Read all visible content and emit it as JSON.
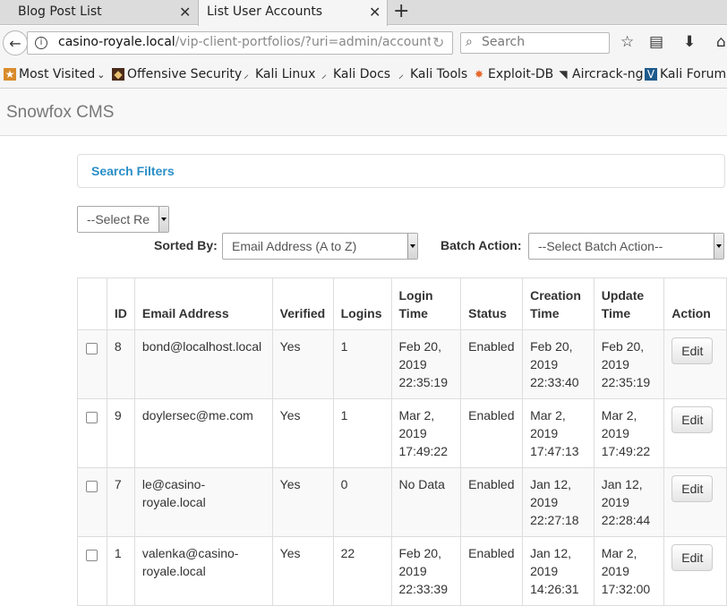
{
  "browser": {
    "tabs": [
      {
        "title": "Blog Post List",
        "active": false
      },
      {
        "title": "List User Accounts",
        "active": true
      }
    ],
    "url_domain": "casino-royale.local",
    "url_path": "/vip-client-portfolios/?uri=admin/accounts",
    "search_placeholder": "Search",
    "bookmarks": [
      {
        "label": "Most Visited",
        "icon": "most-visited-icon"
      },
      {
        "label": "Offensive Security",
        "icon": "offsec-icon"
      },
      {
        "label": "Kali Linux",
        "icon": "kali-icon"
      },
      {
        "label": "Kali Docs",
        "icon": "kali-icon"
      },
      {
        "label": "Kali Tools",
        "icon": "kali-icon"
      },
      {
        "label": "Exploit-DB",
        "icon": "exploitdb-icon"
      },
      {
        "label": "Aircrack-ng",
        "icon": "aircrack-icon"
      },
      {
        "label": "Kali Forums",
        "icon": "kali-forums-icon"
      }
    ]
  },
  "app": {
    "brand": "Snowfox CMS",
    "search_filters": "Search Filters",
    "select_role": "--Select Re",
    "sorted_by_label": "Sorted By:",
    "sorted_by_value": "Email Address (A to Z)",
    "batch_action_label": "Batch Action:",
    "batch_action_value": "--Select Batch Action--"
  },
  "table": {
    "headers": {
      "id": "ID",
      "email": "Email Address",
      "verified": "Verified",
      "logins": "Logins",
      "login_time_1": "Login",
      "login_time_2": "Time",
      "status": "Status",
      "creation_1": "Creation",
      "creation_2": "Time",
      "update_1": "Update",
      "update_2": "Time",
      "action": "Action"
    },
    "rows": [
      {
        "id": "8",
        "email_1": "bond@localhost.local",
        "email_2": "",
        "verified": "Yes",
        "logins": "1",
        "login_1": "Feb 20,",
        "login_2": "2019",
        "login_3": "22:35:19",
        "status": "Enabled",
        "created_1": "Feb 20,",
        "created_2": "2019",
        "created_3": "22:33:40",
        "updated_1": "Feb 20,",
        "updated_2": "2019",
        "updated_3": "22:35:19",
        "action": "Edit"
      },
      {
        "id": "9",
        "email_1": "doylersec@me.com",
        "email_2": "",
        "verified": "Yes",
        "logins": "1",
        "login_1": "Mar 2,",
        "login_2": "2019",
        "login_3": "17:49:22",
        "status": "Enabled",
        "created_1": "Mar 2,",
        "created_2": "2019",
        "created_3": "17:47:13",
        "updated_1": "Mar 2,",
        "updated_2": "2019",
        "updated_3": "17:49:22",
        "action": "Edit"
      },
      {
        "id": "7",
        "email_1": "le@casino-",
        "email_2": "royale.local",
        "verified": "Yes",
        "logins": "0",
        "login_1": "No Data",
        "login_2": "",
        "login_3": "",
        "status": "Enabled",
        "created_1": "Jan 12,",
        "created_2": "2019",
        "created_3": "22:27:18",
        "updated_1": "Jan 12,",
        "updated_2": "2019",
        "updated_3": "22:28:44",
        "action": "Edit"
      },
      {
        "id": "1",
        "email_1": "valenka@casino-",
        "email_2": "royale.local",
        "verified": "Yes",
        "logins": "22",
        "login_1": "Feb 20,",
        "login_2": "2019",
        "login_3": "22:33:39",
        "status": "Enabled",
        "created_1": "Jan 12,",
        "created_2": "2019",
        "created_3": "14:26:31",
        "updated_1": "Mar 2,",
        "updated_2": "2019",
        "updated_3": "17:32:00",
        "action": "Edit"
      }
    ]
  }
}
